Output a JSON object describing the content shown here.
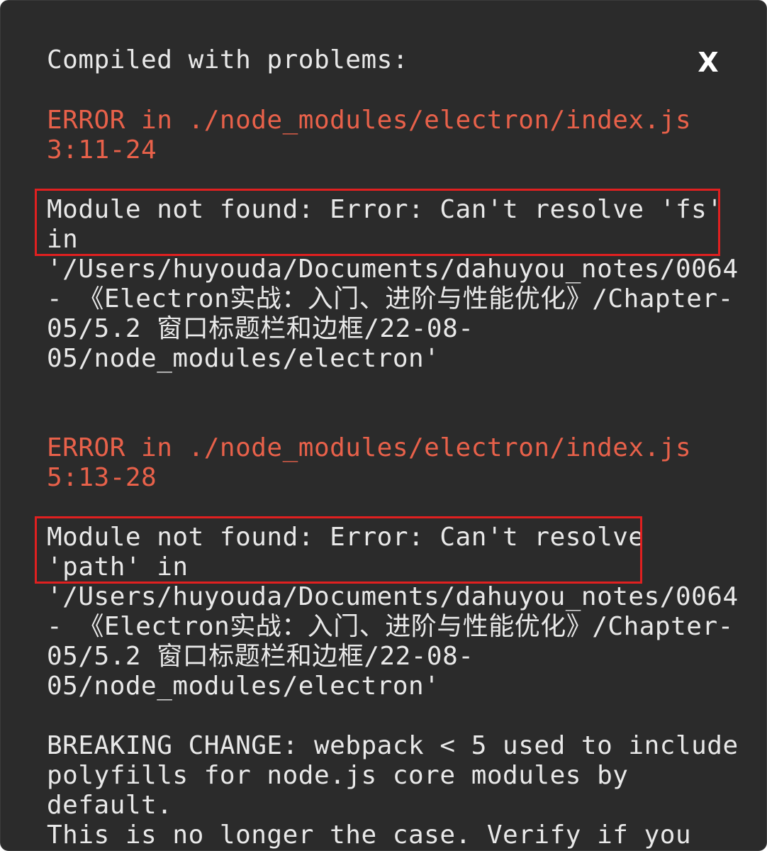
{
  "overlay": {
    "title": "Compiled with problems:",
    "close_label": "X"
  },
  "errors": [
    {
      "header": "ERROR in ./node_modules/electron/index.js\n3:11-24",
      "message": "Module not found: Error: Can't resolve 'fs'\nin\n'/Users/huyouda/Documents/dahuyou_notes/0064\n- 《Electron实战：入门、进阶与性能优化》/Chapter-\n05/5.2 窗口标题栏和边框/22-08-\n05/node_modules/electron'"
    },
    {
      "header": "ERROR in ./node_modules/electron/index.js\n5:13-28",
      "message": "Module not found: Error: Can't resolve\n'path' in\n'/Users/huyouda/Documents/dahuyou_notes/0064\n- 《Electron实战：入门、进阶与性能优化》/Chapter-\n05/5.2 窗口标题栏和边框/22-08-\n05/node_modules/electron'\n\nBREAKING CHANGE: webpack < 5 used to include\npolyfills for node.js core modules by\ndefault.\nThis is no longer the case. Verify if you"
    }
  ],
  "colors": {
    "background": "#2b2b2b",
    "text": "#e8e8e8",
    "error_header": "#e8614a",
    "highlight_box": "#e02020"
  }
}
